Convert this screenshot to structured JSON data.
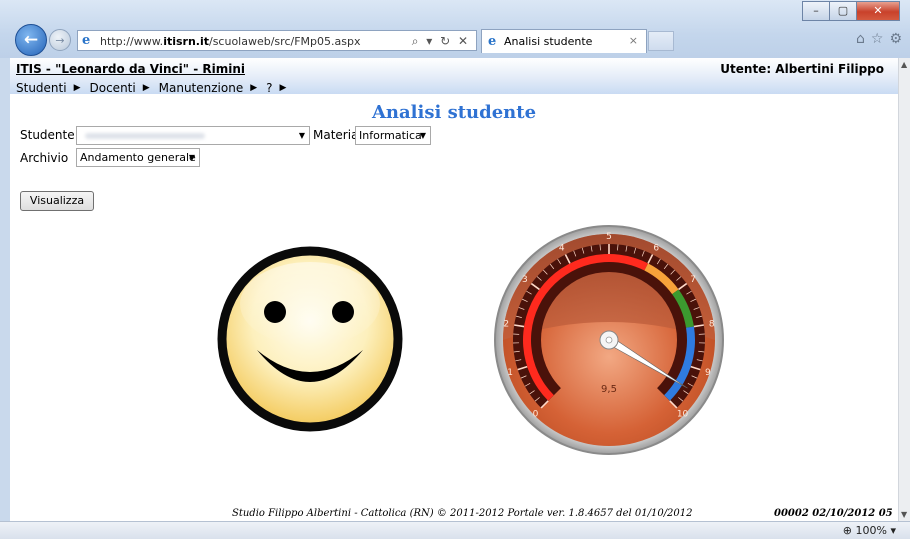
{
  "browser": {
    "url_prefix": "http://www.",
    "url_domain": "itisrn.it",
    "url_path": "/scuolaweb/src/FMp05.aspx",
    "address_actions": "⌕ ▾ ↻ ✕",
    "tab_title": "Analisi studente",
    "tab_close": "×",
    "zoom": "100%",
    "window_buttons": {
      "minimize": "–",
      "maximize": "▢",
      "close": "✕"
    }
  },
  "header": {
    "school": "ITIS - \"Leonardo da Vinci\" - Rimini",
    "user": "Utente: Albertini Filippo",
    "menu": [
      "Studenti",
      "Docenti",
      "Manutenzione",
      "?"
    ]
  },
  "page": {
    "title": "Analisi studente",
    "student_label": "Studente",
    "materia_label": "Materia",
    "materia_value": "Informatica",
    "archivio_label": "Archivio",
    "archivio_value": "Andamento generale",
    "visualizza_label": "Visualizza"
  },
  "gauge": {
    "min": 0,
    "max": 10,
    "value": 9.5,
    "value_label": "9,5",
    "tick_labels": [
      "0",
      "1",
      "2",
      "3",
      "4",
      "5",
      "6",
      "7",
      "8",
      "9",
      "10"
    ],
    "bands": [
      {
        "from": 0,
        "to": 6,
        "color": "#ff2a1e"
      },
      {
        "from": 6,
        "to": 7,
        "color": "#f7a23a"
      },
      {
        "from": 7,
        "to": 8,
        "color": "#3c9a2f"
      },
      {
        "from": 8,
        "to": 10,
        "color": "#2f7be0"
      }
    ]
  },
  "footer": {
    "center": "Studio Filippo Albertini - Cattolica (RN) © 2011-2012     Portale ver. 1.8.4657 del 01/10/2012",
    "right": "00002  02/10/2012  05"
  }
}
